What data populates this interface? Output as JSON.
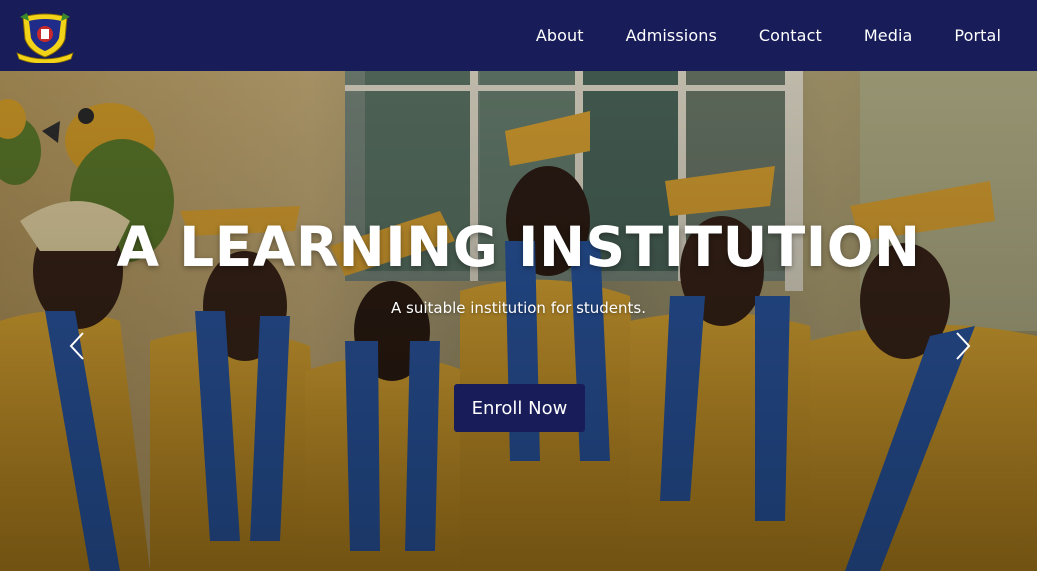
{
  "nav": {
    "links": [
      "About",
      "Admissions",
      "Contact",
      "Media",
      "Portal"
    ]
  },
  "hero": {
    "title": "A LEARNING INSTITUTION",
    "subtitle": "A suitable institution for students.",
    "button_label": "Enroll Now"
  },
  "colors": {
    "navbar_bg": "#181d5a",
    "button_bg": "#181d5a",
    "gown": "#e0a72e",
    "stole": "#2c5aa8",
    "logo_shield": "#f2d318"
  },
  "icons": {
    "prev": "chevron-left-icon",
    "next": "chevron-right-icon"
  }
}
